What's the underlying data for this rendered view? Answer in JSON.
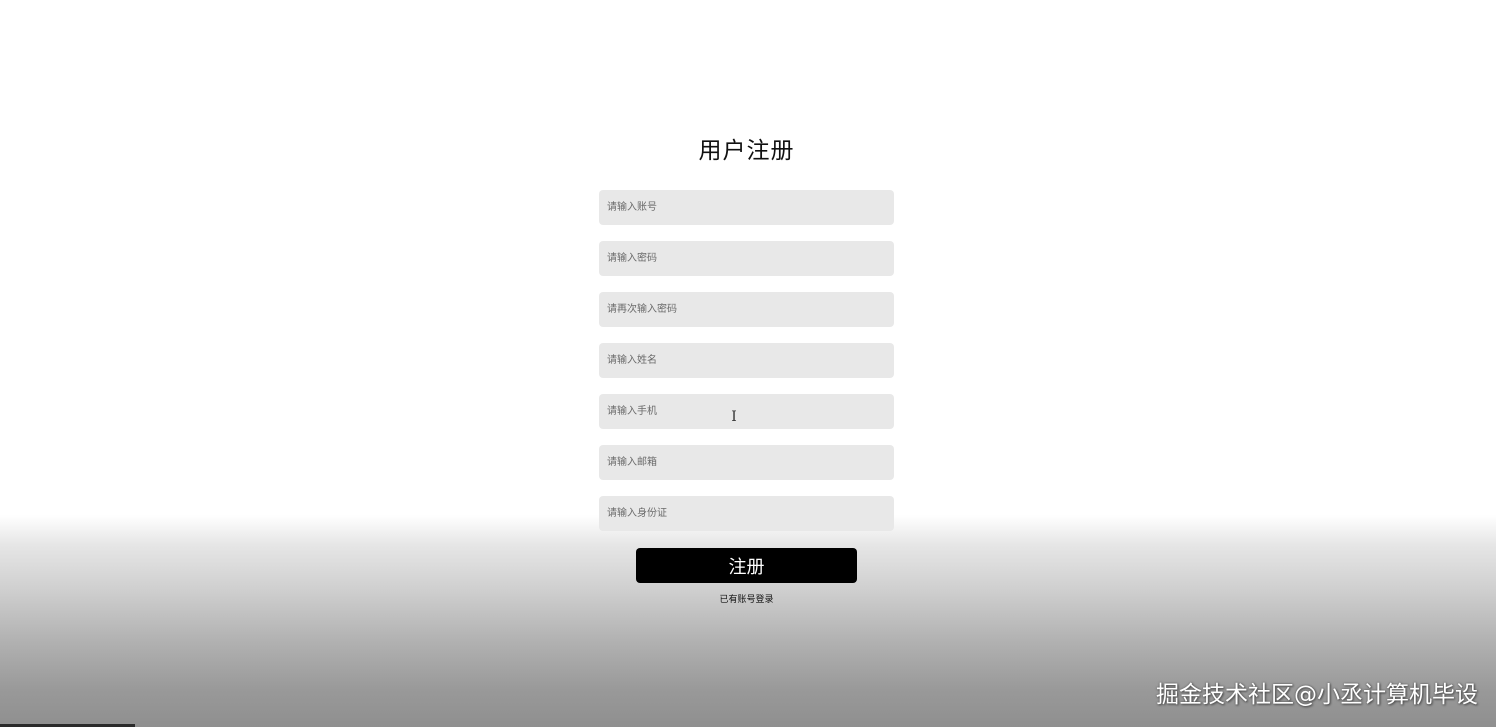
{
  "form": {
    "title": "用户注册",
    "fields": {
      "account": {
        "placeholder": "请输入账号"
      },
      "password": {
        "placeholder": "请输入密码"
      },
      "confirm_password": {
        "placeholder": "请再次输入密码"
      },
      "name": {
        "placeholder": "请输入姓名"
      },
      "phone": {
        "placeholder": "请输入手机"
      },
      "email": {
        "placeholder": "请输入邮箱"
      },
      "id_card": {
        "placeholder": "请输入身份证"
      }
    },
    "submit_label": "注册",
    "login_link": "已有账号登录"
  },
  "cursor_glyph": "I",
  "watermark": "掘金技术社区@小丞计算机毕设",
  "colors": {
    "button_bg": "#000000",
    "button_text": "#ffffff",
    "field_bg": "#e8e8e8"
  }
}
